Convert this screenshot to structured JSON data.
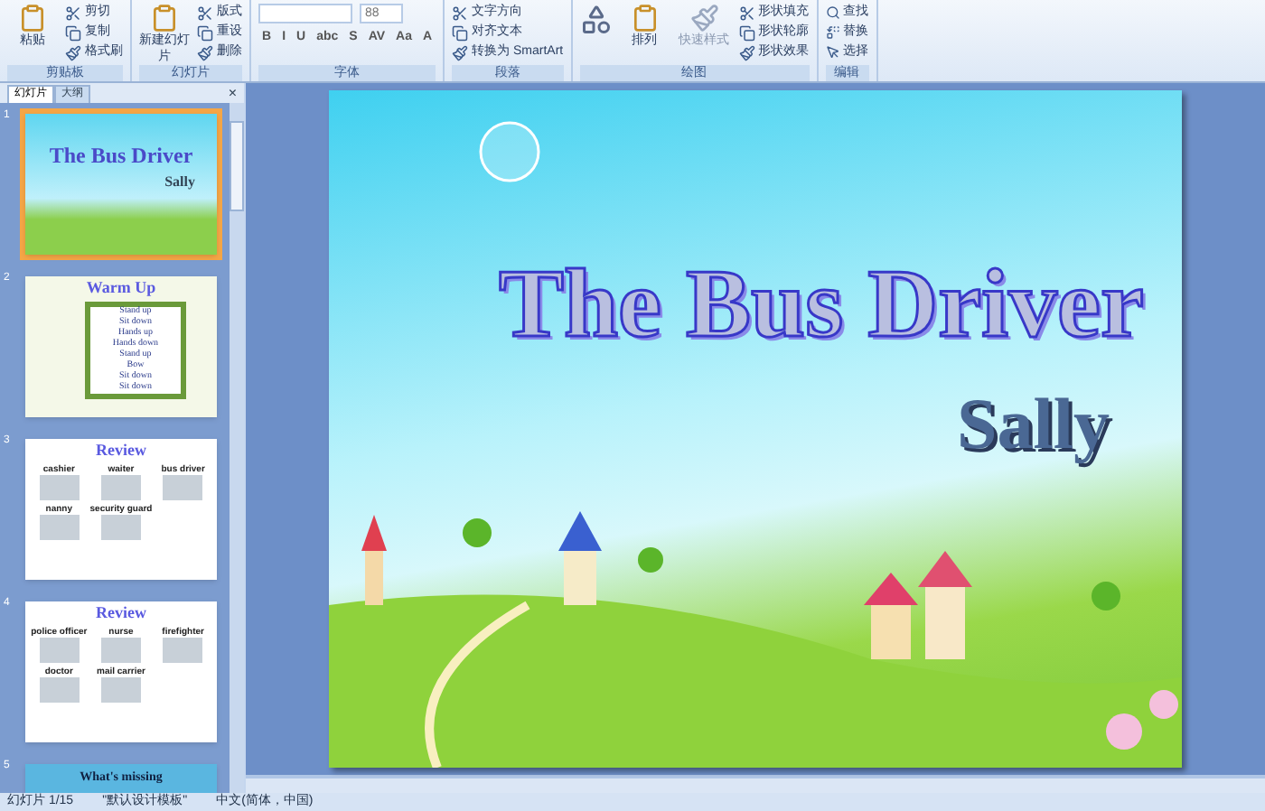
{
  "ribbon": {
    "groups": [
      {
        "label": "剪贴板",
        "big": {
          "label": "粘贴"
        },
        "items": [
          "剪切",
          "复制",
          "格式刷"
        ]
      },
      {
        "label": "幻灯片",
        "big": {
          "label": "新建幻灯片"
        },
        "items": [
          "版式",
          "重设",
          "删除"
        ]
      },
      {
        "label": "字体",
        "font_size": "88",
        "format_buttons": [
          "B",
          "I",
          "U",
          "abc",
          "S",
          "AV",
          "Aa",
          "A"
        ]
      },
      {
        "label": "段落",
        "items": [
          "文字方向",
          "对齐文本",
          "转换为 SmartArt"
        ]
      },
      {
        "label": "绘图",
        "big": {
          "label": "排列"
        },
        "big2": {
          "label": "快速样式"
        },
        "items": [
          "形状填充",
          "形状轮廓",
          "形状效果"
        ]
      },
      {
        "label": "编辑",
        "items": [
          "查找",
          "替换",
          "选择"
        ]
      }
    ]
  },
  "panel": {
    "tabs": [
      {
        "label": "幻灯片",
        "selected": true
      },
      {
        "label": "大纲",
        "selected": false
      }
    ],
    "close": "×",
    "slides": [
      {
        "number": "1",
        "selected": true,
        "kind": "title",
        "title": "The Bus Driver",
        "labels": [
          "Sally"
        ]
      },
      {
        "number": "2",
        "selected": false,
        "kind": "list",
        "title": "Warm Up",
        "labels": [
          "Stand up",
          "Sit down",
          "Hands up",
          "Hands down",
          "Stand up",
          "Bow",
          "Sit down",
          "Sit down"
        ]
      },
      {
        "number": "3",
        "selected": false,
        "kind": "grid",
        "title": "Review",
        "labels": [
          "cashier",
          "waiter",
          "bus driver",
          "nanny",
          "security guard"
        ]
      },
      {
        "number": "4",
        "selected": false,
        "kind": "grid",
        "title": "Review",
        "labels": [
          "police officer",
          "nurse",
          "firefighter",
          "doctor",
          "mail carrier"
        ]
      },
      {
        "number": "5",
        "selected": false,
        "kind": "banner",
        "title": "What's missing"
      }
    ]
  },
  "slide": {
    "title": "The Bus Driver",
    "subtitle": "Sally"
  },
  "status_bar": {
    "slide": "幻灯片 1/15",
    "theme": "\"默认设计模板\"",
    "language": "中文(简体，中国)"
  }
}
